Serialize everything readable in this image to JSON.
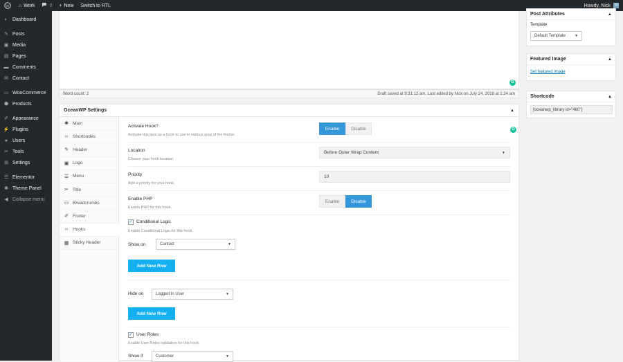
{
  "adminbar": {
    "site": "Work",
    "comments_count": "0",
    "new_label": "New",
    "rtl_label": "Switch to RTL",
    "howdy": "Howdy, Nick",
    "avatar_letter": "N"
  },
  "sidebar": {
    "items": [
      {
        "label": "Dashboard",
        "icon": "dashboard-icon"
      },
      {
        "label": "Posts",
        "icon": "pin-icon"
      },
      {
        "label": "Media",
        "icon": "media-icon"
      },
      {
        "label": "Pages",
        "icon": "pages-icon"
      },
      {
        "label": "Comments",
        "icon": "comments-icon"
      },
      {
        "label": "Contact",
        "icon": "contact-icon"
      },
      {
        "label": "WooCommerce",
        "icon": "woo-icon"
      },
      {
        "label": "Products",
        "icon": "products-icon"
      },
      {
        "label": "Appearance",
        "icon": "brush-icon"
      },
      {
        "label": "Plugins",
        "icon": "plugin-icon"
      },
      {
        "label": "Users",
        "icon": "users-icon"
      },
      {
        "label": "Tools",
        "icon": "wrench-icon"
      },
      {
        "label": "Settings",
        "icon": "settings-icon"
      },
      {
        "label": "Elementor",
        "icon": "elementor-icon"
      },
      {
        "label": "Theme Panel",
        "icon": "gear-icon"
      }
    ],
    "collapse": "Collapse menu"
  },
  "editor": {
    "word_count": "Word count: 2",
    "draft_status": "Draft saved at 9:31:12 am. Last edited by Nick on July 24, 2018 at 1:24 am"
  },
  "oceanwp": {
    "title": "OceanWP Settings",
    "tabs": [
      "Main",
      "Shortcodes",
      "Header",
      "Logo",
      "Menu",
      "Title",
      "Breadcrumbs",
      "Footer",
      "Hooks",
      "Sticky Header"
    ],
    "activate": {
      "label": "Activate Hook?",
      "desc": "Activate this item as a hook to use in various area of the theme.",
      "enable": "Enable",
      "disable": "Disable"
    },
    "location": {
      "label": "Location",
      "desc": "Choose your hook location.",
      "value": "Before Outer Wrap Content"
    },
    "priority": {
      "label": "Priority",
      "desc": "Add a priority for your hook.",
      "value": "10"
    },
    "php": {
      "label": "Enable PHP",
      "desc": "Enable PHP for this hook.",
      "enable": "Enable",
      "disable": "Disable"
    },
    "conditional": {
      "label": "Conditional Logic",
      "desc": "Enable Conditional Logic for this hook.",
      "show_on_label": "Show on",
      "show_on_value": "Contact",
      "add_row": "Add New Row",
      "hide_on_label": "Hide on",
      "hide_on_value": "Logged In User",
      "add_row2": "Add New Row"
    },
    "roles": {
      "label": "User Roles",
      "desc": "Enable User Roles validation for this hook.",
      "show_if_label": "Show if",
      "show_if_value": "Customer"
    }
  },
  "right": {
    "post_attributes": {
      "title": "Post Attributes",
      "template_label": "Template",
      "template_value": "Default Template"
    },
    "featured": {
      "title": "Featured Image",
      "link": "Set featured image"
    },
    "shortcode": {
      "title": "Shortcode",
      "value": "[oceanwp_library id=\"460\"]"
    }
  },
  "colors": {
    "accent": "#3497da",
    "button": "#13aff0",
    "grammarly": "#15c39a",
    "admin_bg": "#23282d"
  }
}
